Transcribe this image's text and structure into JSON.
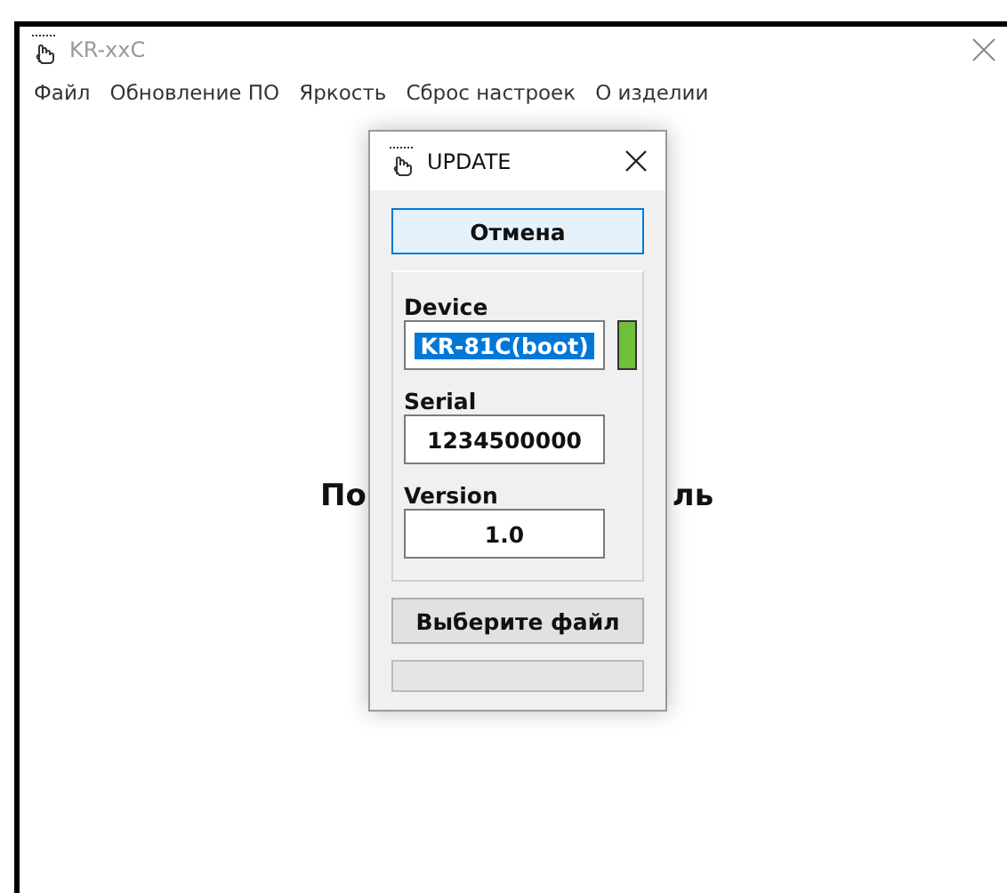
{
  "window": {
    "title": "KR-xxC"
  },
  "menu": [
    {
      "label": "Файл"
    },
    {
      "label": "Обновление ПО"
    },
    {
      "label": "Яркость"
    },
    {
      "label": "Сброс настроек"
    },
    {
      "label": "О изделии"
    }
  ],
  "background_text": {
    "left": "По",
    "right": "ль"
  },
  "dialog": {
    "title": "UPDATE",
    "cancel_button": "Отмена",
    "fields": [
      {
        "label": "Device",
        "value": "KR-81C(boot)",
        "selected": true,
        "connected": true
      },
      {
        "label": "Serial",
        "value": "1234500000",
        "selected": false
      },
      {
        "label": "Version",
        "value": "1.0",
        "selected": false
      }
    ],
    "file_button": "Выберите файл",
    "progress": {
      "level": 0
    }
  }
}
